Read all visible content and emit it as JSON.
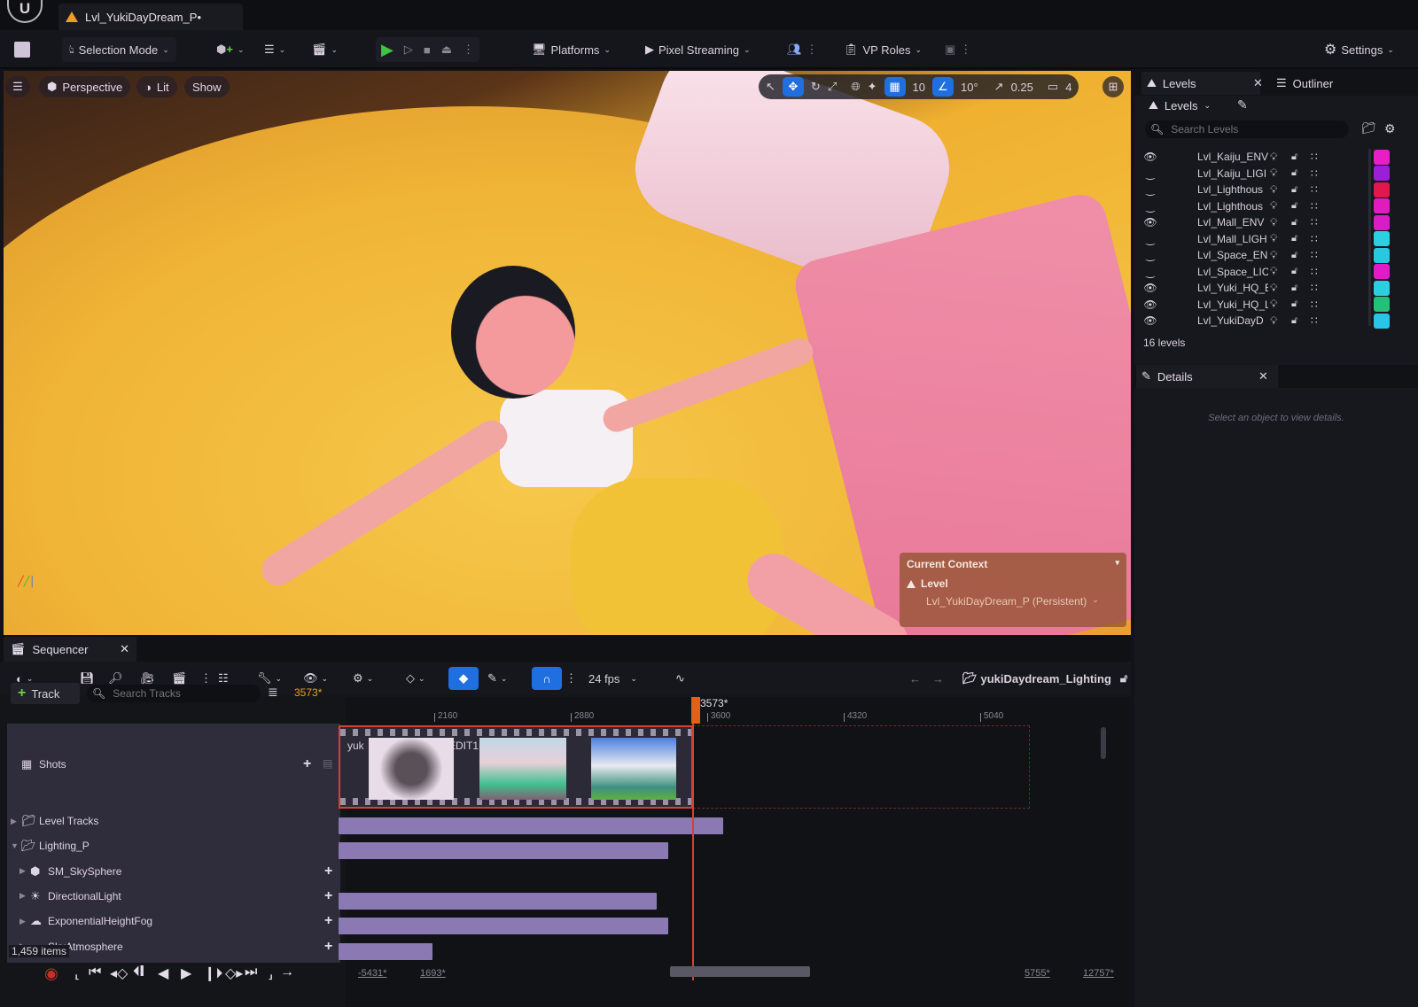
{
  "titlebar": {
    "logo": "U",
    "document_tab": "Lvl_YukiDayDream_P•"
  },
  "toolbar": {
    "selection_mode": "Selection Mode",
    "platforms": "Platforms",
    "pixel_streaming": "Pixel Streaming",
    "vp_roles": "VP Roles",
    "settings": "Settings"
  },
  "viewport": {
    "menu_icon": "hamburger-icon",
    "perspective": "Perspective",
    "lit": "Lit",
    "show": "Show",
    "grid_snap_value": "10",
    "rotation_snap_value": "10°",
    "scale_snap_value": "0.25",
    "camera_speed": "4",
    "current_context": {
      "title": "Current Context",
      "level_label": "Level",
      "level_value": "Lvl_YukiDayDream_P (Persistent)"
    }
  },
  "levels_panel": {
    "tab_label": "Levels",
    "outliner_tab_label": "Outliner",
    "levels_dropdown": "Levels",
    "search_placeholder": "Search Levels",
    "count_label": "16 levels",
    "rows": [
      {
        "name": "Lvl_Kaiju_ENV",
        "visible": true,
        "color": "#e81ec8"
      },
      {
        "name": "Lvl_Kaiju_LIGI",
        "visible": false,
        "color": "#9b1fd8"
      },
      {
        "name": "Lvl_Lighthous",
        "visible": false,
        "color": "#e0184e"
      },
      {
        "name": "Lvl_Lighthous",
        "visible": false,
        "color": "#e01cc0"
      },
      {
        "name": "Lvl_Mall_ENV",
        "visible": true,
        "color": "#d81cc8"
      },
      {
        "name": "Lvl_Mall_LIGH",
        "visible": false,
        "color": "#2cd0e0"
      },
      {
        "name": "Lvl_Space_EN",
        "visible": false,
        "color": "#28c8e0"
      },
      {
        "name": "Lvl_Space_LIC",
        "visible": false,
        "color": "#e01cc8"
      },
      {
        "name": "Lvl_Yuki_HQ_E",
        "visible": true,
        "color": "#2ccfe0"
      },
      {
        "name": "Lvl_Yuki_HQ_L",
        "visible": true,
        "color": "#22c078"
      },
      {
        "name": "Lvl_YukiDayD",
        "visible": true,
        "color": "#2ac4e8"
      }
    ]
  },
  "details_panel": {
    "tab_label": "Details",
    "empty_message": "Select an object to view details."
  },
  "sequencer": {
    "tab_label": "Sequencer",
    "fps": "24 fps",
    "sequence_name": "yukiDaydream_Lighting",
    "add_track_label": "Track",
    "search_placeholder": "Search Tracks",
    "current_frame": "3573*",
    "playhead_label": "3573*",
    "ruler_ticks": [
      "2160",
      "2880",
      "3600",
      "4320",
      "5040"
    ],
    "shots_label": "Shots",
    "shot_names": [
      "yuk",
      "EDIT1"
    ],
    "tracks": [
      {
        "label": "Level Tracks",
        "depth": 0,
        "expanded": false,
        "icon": "folder-icon",
        "has_add": false,
        "bar_fraction": 0.49
      },
      {
        "label": "Lighting_P",
        "depth": 0,
        "expanded": true,
        "icon": "folder-open-icon",
        "has_add": false,
        "bar_fraction": 0.42
      },
      {
        "label": "SM_SkySphere",
        "depth": 1,
        "expanded": false,
        "icon": "mesh-icon",
        "has_add": true,
        "bar_fraction": 0
      },
      {
        "label": "DirectionalLight",
        "depth": 1,
        "expanded": false,
        "icon": "sun-icon",
        "has_add": true,
        "bar_fraction": 0.405
      },
      {
        "label": "ExponentialHeightFog",
        "depth": 1,
        "expanded": false,
        "icon": "fog-icon",
        "has_add": true,
        "bar_fraction": 0.42
      },
      {
        "label": "SkyAtmosphere",
        "depth": 1,
        "expanded": false,
        "icon": "atmosphere-icon",
        "has_add": true,
        "bar_fraction": 0.12
      }
    ],
    "item_count": "1,459 items",
    "view_range": {
      "start": "-5431*",
      "in": "1693*",
      "out": "5755*",
      "end": "12757*"
    }
  },
  "colors": {
    "accent_blue": "#1f6fe0",
    "playhead_orange": "#e0601c",
    "frame_orange": "#e89a2a",
    "track_bar": "#8b79b4",
    "play_green": "#3ec43e"
  }
}
